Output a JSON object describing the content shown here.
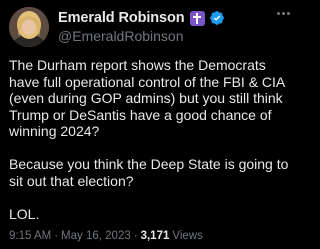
{
  "tweet": {
    "author": {
      "display_name": "Emerald Robinson",
      "handle": "@EmeraldRobinson",
      "badges": [
        "latin-cross-icon",
        "verified-badge-icon"
      ]
    },
    "text": "The Durham report shows the Democrats have full operational control of the FBI & CIA (even during GOP admins) but you still think Trump or DeSantis have a good chance of winning 2024?\n\nBecause you think the Deep State is going to sit out that election?\n\nLOL.",
    "time": "9:15 AM",
    "separator": "·",
    "date": "May 16, 2023",
    "views_count": "3,171",
    "views_label": "Views"
  },
  "colors": {
    "background": "#000000",
    "primary_text": "#e7e9ea",
    "secondary_text": "#71767b",
    "verified_blue": "#1d9bf0",
    "cross_badge": "#7b55c8"
  }
}
